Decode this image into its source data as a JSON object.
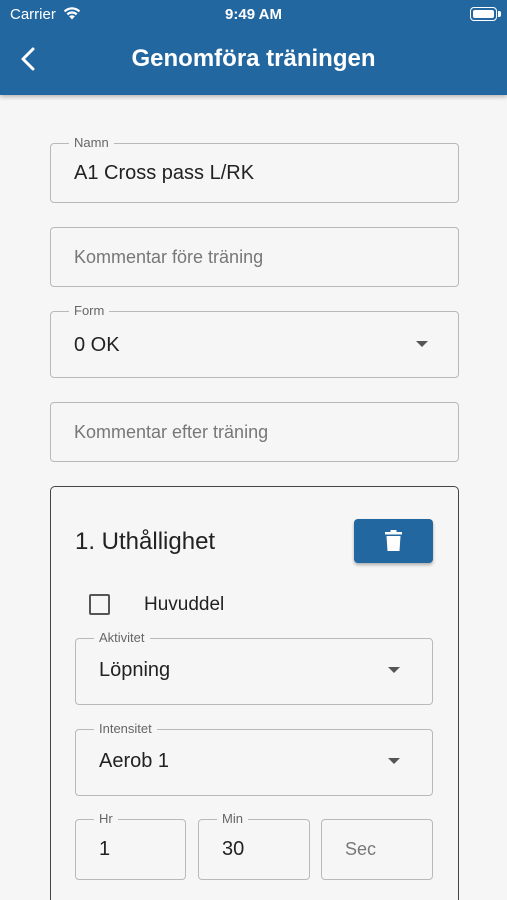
{
  "status_bar": {
    "carrier": "Carrier",
    "time": "9:49 AM"
  },
  "header": {
    "title": "Genomföra träningen",
    "back_icon": "chevron-left-icon"
  },
  "form": {
    "name": {
      "label": "Namn",
      "value": "A1 Cross pass L/RK"
    },
    "comment_before": {
      "placeholder": "Kommentar före träning"
    },
    "form_select": {
      "label": "Form",
      "value": "0 OK"
    },
    "comment_after": {
      "placeholder": "Kommentar efter träning"
    }
  },
  "section": {
    "title": "1. Uthållighet",
    "delete_icon": "trash-icon",
    "main_part": {
      "label": "Huvuddel",
      "checked": false
    },
    "activity": {
      "label": "Aktivitet",
      "value": "Löpning"
    },
    "intensity": {
      "label": "Intensitet",
      "value": "Aerob 1"
    },
    "hours": {
      "label": "Hr",
      "value": "1"
    },
    "minutes": {
      "label": "Min",
      "value": "30"
    },
    "seconds": {
      "placeholder": "Sec"
    }
  },
  "colors": {
    "primary": "#2367a0",
    "background": "#f6f6f6",
    "border": "#b9b9b9"
  }
}
